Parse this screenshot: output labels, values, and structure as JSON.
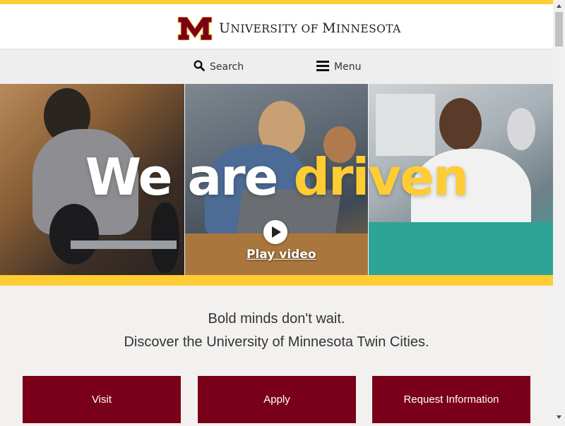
{
  "header": {
    "wordmark_parts": [
      "U",
      "NIVERSITY OF ",
      "M",
      "INNESOTA"
    ]
  },
  "nav": {
    "search_label": "Search",
    "menu_label": "Menu"
  },
  "hero": {
    "title_white": "We are ",
    "title_gold": "driven",
    "play_label": "Play video"
  },
  "intro": {
    "line1": "Bold minds don't wait.",
    "line2": "Discover the University of Minnesota Twin Cities."
  },
  "cta": [
    {
      "label": "Visit"
    },
    {
      "label": "Apply"
    },
    {
      "label": "Request Information"
    }
  ],
  "colors": {
    "maroon": "#7a0019",
    "gold": "#ffcc33"
  },
  "icons": {
    "logo": "block-m-logo",
    "search": "search-icon",
    "menu": "hamburger-icon",
    "play": "play-icon"
  }
}
